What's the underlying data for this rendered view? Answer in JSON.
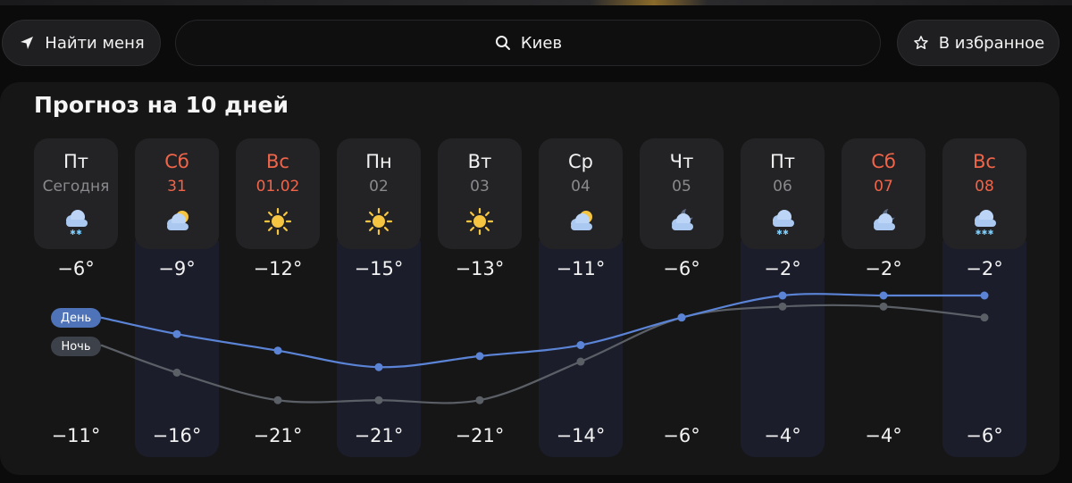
{
  "header": {
    "find_me_label": "Найти меня",
    "search_value": "Киев",
    "favorite_label": "В избранное"
  },
  "forecast": {
    "title": "Прогноз на 10 дней",
    "legend_day": "День",
    "legend_night": "Ночь",
    "colors": {
      "day_line": "#5b84d6",
      "night_line": "#5b5f66",
      "weekend": "#f0644a"
    },
    "days": [
      {
        "name": "Пт",
        "date": "Сегодня",
        "icon": "snow-cloud-icon",
        "weekend": false,
        "highlight": false,
        "max": "−6°",
        "min": "−11°",
        "max_val": -6,
        "min_val": -11
      },
      {
        "name": "Сб",
        "date": "31",
        "icon": "partly-cloudy-icon",
        "weekend": true,
        "highlight": true,
        "max": "−9°",
        "min": "−16°",
        "max_val": -9,
        "min_val": -16
      },
      {
        "name": "Вс",
        "date": "01.02",
        "icon": "sun-icon",
        "weekend": true,
        "highlight": false,
        "max": "−12°",
        "min": "−21°",
        "max_val": -12,
        "min_val": -21
      },
      {
        "name": "Пн",
        "date": "02",
        "icon": "sun-icon",
        "weekend": false,
        "highlight": true,
        "max": "−15°",
        "min": "−21°",
        "max_val": -15,
        "min_val": -21
      },
      {
        "name": "Вт",
        "date": "03",
        "icon": "sun-icon",
        "weekend": false,
        "highlight": false,
        "max": "−13°",
        "min": "−21°",
        "max_val": -13,
        "min_val": -21
      },
      {
        "name": "Ср",
        "date": "04",
        "icon": "partly-cloudy-icon",
        "weekend": false,
        "highlight": true,
        "max": "−11°",
        "min": "−14°",
        "max_val": -11,
        "min_val": -14
      },
      {
        "name": "Чт",
        "date": "05",
        "icon": "night-cloud-icon",
        "weekend": false,
        "highlight": false,
        "max": "−6°",
        "min": "−6°",
        "max_val": -6,
        "min_val": -6
      },
      {
        "name": "Пт",
        "date": "06",
        "icon": "snow-cloud-icon",
        "weekend": false,
        "highlight": true,
        "max": "−2°",
        "min": "−4°",
        "max_val": -2,
        "min_val": -4
      },
      {
        "name": "Сб",
        "date": "07",
        "icon": "night-cloud-icon",
        "weekend": true,
        "highlight": false,
        "max": "−2°",
        "min": "−4°",
        "max_val": -2,
        "min_val": -4
      },
      {
        "name": "Вс",
        "date": "08",
        "icon": "heavy-snow-cloud-icon",
        "weekend": true,
        "highlight": true,
        "max": "−2°",
        "min": "−6°",
        "max_val": -2,
        "min_val": -6
      }
    ]
  }
}
